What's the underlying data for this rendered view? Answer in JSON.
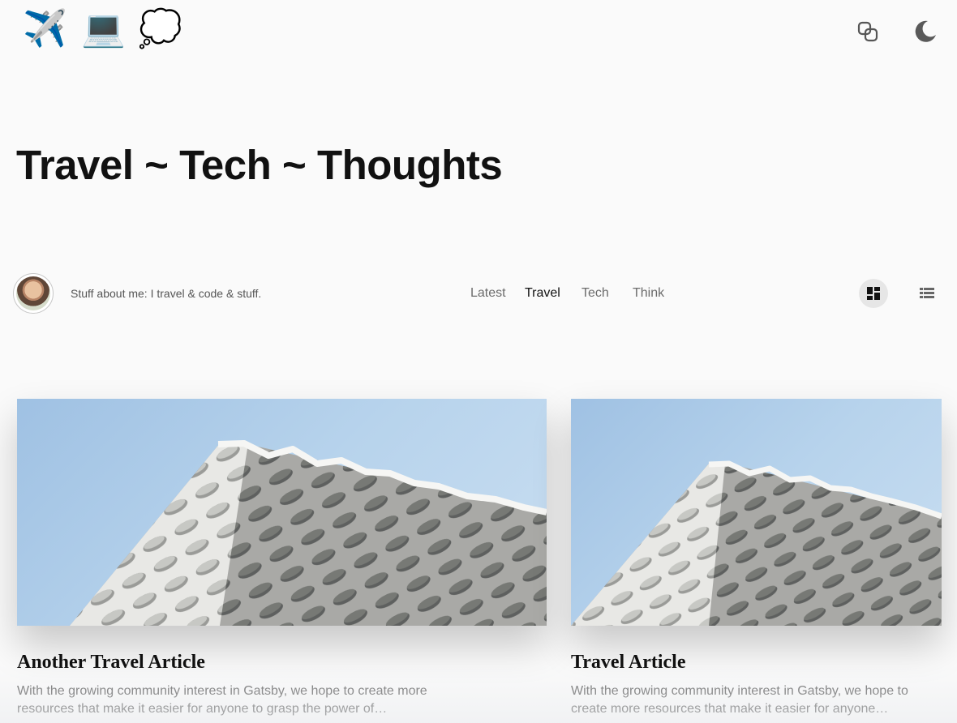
{
  "header": {
    "logo_links": [
      {
        "emoji": "✈️",
        "icon": "airplane-icon"
      },
      {
        "emoji": "💻",
        "icon": "laptop-icon"
      },
      {
        "emoji": "💭",
        "icon": "thought-bubble-icon"
      }
    ],
    "right_icons": [
      "copy-icon",
      "moon-icon"
    ]
  },
  "hero": {
    "title": "Travel ~ Tech ~ Thoughts"
  },
  "profile": {
    "bio": "Stuff about me: I travel & code & stuff."
  },
  "navigation": {
    "tabs": [
      "Latest",
      "Travel",
      "Tech",
      "Think"
    ],
    "active": "Travel"
  },
  "view_toggle": {
    "options": [
      "grid-view-icon",
      "list-view-icon"
    ],
    "active": "grid-view-icon"
  },
  "articles": [
    {
      "title": "Another Travel Article",
      "excerpt": "With the growing community interest in Gatsby, we hope to create more resources that make it easier for anyone to grasp the power of…"
    },
    {
      "title": "Travel Article",
      "excerpt": "With the growing community interest in Gatsby, we hope to create more resources that make it easier for anyone…"
    }
  ],
  "colors": {
    "background": "#fafafa",
    "active_tab_pill": "#e6e6e6",
    "sky": "#b7d3ec"
  }
}
